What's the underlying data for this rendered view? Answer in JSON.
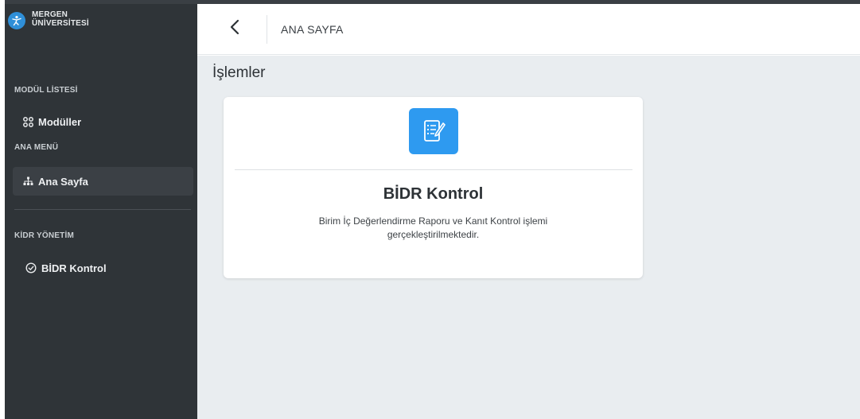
{
  "brand": {
    "line1": "MERGEN",
    "line2": "ÜNİVERSİTESİ",
    "logo_icon": "figure-icon",
    "logo_color": "#2f8fd8"
  },
  "sidebar": {
    "sections": [
      {
        "title": "MODÜL LİSTESİ"
      },
      {
        "title": "ANA MENÜ"
      },
      {
        "title": "KİDR YÖNETİM"
      }
    ],
    "items": [
      {
        "label": "Modüller",
        "icon": "grid-icon",
        "active": false
      },
      {
        "label": "Ana Sayfa",
        "icon": "sitemap-icon",
        "active": true
      },
      {
        "label": "BİDR Kontrol",
        "icon": "check-circle-icon",
        "active": false
      }
    ],
    "bg_color": "#2f3438"
  },
  "header": {
    "back_icon": "chevron-left-icon",
    "breadcrumb": "ANA SAYFA"
  },
  "main": {
    "title": "İşlemler",
    "cards": [
      {
        "icon": "document-edit-icon",
        "title": "BİDR Kontrol",
        "description_line1": "Birim İç Değerlendirme Raporu ve Kanıt Kontrol işlemi",
        "description_line2": "gerçekleştirilmektedir.",
        "accent": "#2e9af0"
      }
    ],
    "bg_color": "#e9edf0"
  }
}
